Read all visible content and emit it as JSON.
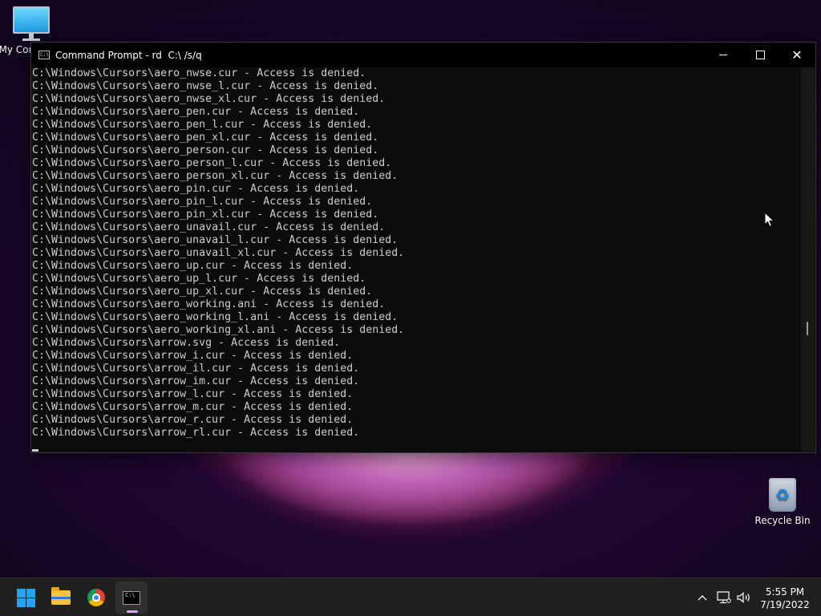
{
  "desktop": {
    "icons": [
      {
        "label": "My Computer"
      },
      {
        "label": "Recycle Bin"
      }
    ]
  },
  "window": {
    "title": "Command Prompt - rd  C:\\ /s/q",
    "app_icon_text": "C:\\",
    "buttons": {
      "minimize": "minimize",
      "maximize": "maximize",
      "close": "close"
    }
  },
  "console": {
    "lines": [
      "C:\\Windows\\Cursors\\aero_nwse.cur - Access is denied.",
      "C:\\Windows\\Cursors\\aero_nwse_l.cur - Access is denied.",
      "C:\\Windows\\Cursors\\aero_nwse_xl.cur - Access is denied.",
      "C:\\Windows\\Cursors\\aero_pen.cur - Access is denied.",
      "C:\\Windows\\Cursors\\aero_pen_l.cur - Access is denied.",
      "C:\\Windows\\Cursors\\aero_pen_xl.cur - Access is denied.",
      "C:\\Windows\\Cursors\\aero_person.cur - Access is denied.",
      "C:\\Windows\\Cursors\\aero_person_l.cur - Access is denied.",
      "C:\\Windows\\Cursors\\aero_person_xl.cur - Access is denied.",
      "C:\\Windows\\Cursors\\aero_pin.cur - Access is denied.",
      "C:\\Windows\\Cursors\\aero_pin_l.cur - Access is denied.",
      "C:\\Windows\\Cursors\\aero_pin_xl.cur - Access is denied.",
      "C:\\Windows\\Cursors\\aero_unavail.cur - Access is denied.",
      "C:\\Windows\\Cursors\\aero_unavail_l.cur - Access is denied.",
      "C:\\Windows\\Cursors\\aero_unavail_xl.cur - Access is denied.",
      "C:\\Windows\\Cursors\\aero_up.cur - Access is denied.",
      "C:\\Windows\\Cursors\\aero_up_l.cur - Access is denied.",
      "C:\\Windows\\Cursors\\aero_up_xl.cur - Access is denied.",
      "C:\\Windows\\Cursors\\aero_working.ani - Access is denied.",
      "C:\\Windows\\Cursors\\aero_working_l.ani - Access is denied.",
      "C:\\Windows\\Cursors\\aero_working_xl.ani - Access is denied.",
      "C:\\Windows\\Cursors\\arrow.svg - Access is denied.",
      "C:\\Windows\\Cursors\\arrow_i.cur - Access is denied.",
      "C:\\Windows\\Cursors\\arrow_il.cur - Access is denied.",
      "C:\\Windows\\Cursors\\arrow_im.cur - Access is denied.",
      "C:\\Windows\\Cursors\\arrow_l.cur - Access is denied.",
      "C:\\Windows\\Cursors\\arrow_m.cur - Access is denied.",
      "C:\\Windows\\Cursors\\arrow_r.cur - Access is denied.",
      "C:\\Windows\\Cursors\\arrow_rl.cur - Access is denied."
    ]
  },
  "taskbar": {
    "apps": [
      {
        "name": "start-icon"
      },
      {
        "name": "file-explorer-icon"
      },
      {
        "name": "chrome-icon"
      },
      {
        "name": "command-prompt-icon"
      }
    ],
    "tray": {
      "chevron": "^",
      "time": "5:55 PM",
      "date": "7/19/2022"
    }
  },
  "colors": {
    "console_bg": "#0c0c0c",
    "console_text": "#cccccc",
    "taskbar_bg": "#202020",
    "start_blue": "#1fa4ff"
  }
}
